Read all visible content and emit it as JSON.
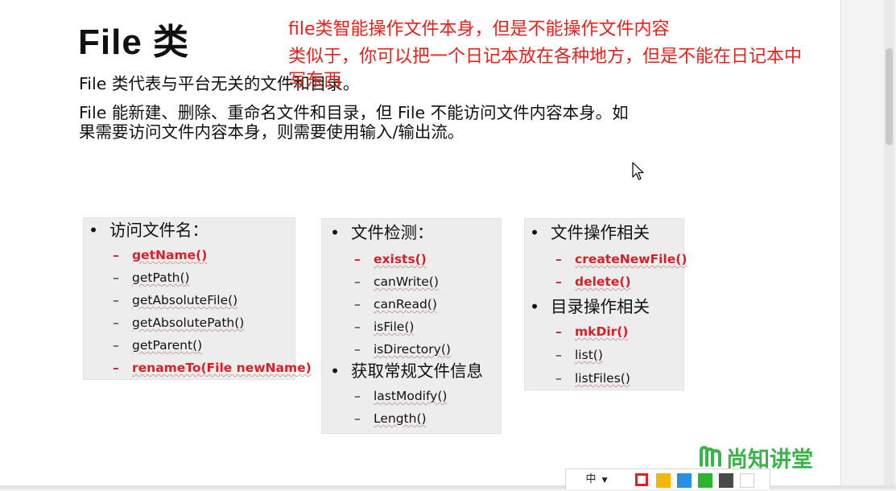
{
  "slide": {
    "title": "File 类",
    "paragraph1": "File 类代表与平台无关的文件和目录。",
    "paragraph2": "File  能新建、删除、重命名文件和目录，但 File 不能访问文件内容本身。如果需要访问文件内容本身，则需要使用输入/输出流。"
  },
  "annotation": {
    "line1": "file类智能操作文件本身，但是不能操作文件内容",
    "line2": "类似于，你可以把一个日记本放在各种地方，但是不能在日记本中",
    "line3": "写东西",
    "color": "#e8201a"
  },
  "box1": {
    "heading": "访问文件名：",
    "items": [
      {
        "text": "getName()",
        "highlight": true
      },
      {
        "text": "getPath()",
        "highlight": false
      },
      {
        "text": "getAbsoluteFile()",
        "highlight": false
      },
      {
        "text": "getAbsolutePath()",
        "highlight": false
      },
      {
        "text": "getParent()",
        "highlight": false
      },
      {
        "text": "renameTo(File newName)",
        "highlight": true
      }
    ]
  },
  "box2": {
    "heading": "文件检测：",
    "items": [
      {
        "text": "exists()",
        "highlight": true
      },
      {
        "text": "canWrite()",
        "highlight": false
      },
      {
        "text": "canRead()",
        "highlight": false
      },
      {
        "text": "isFile()",
        "highlight": false
      },
      {
        "text": "isDirectory()",
        "highlight": false
      }
    ],
    "heading2": "获取常规文件信息",
    "items2": [
      {
        "text": "lastModify()",
        "highlight": false
      },
      {
        "text": "Length()",
        "highlight": false
      }
    ]
  },
  "box3": {
    "heading": "文件操作相关",
    "items": [
      {
        "text": "createNewFile()",
        "highlight": true
      },
      {
        "text": "delete()",
        "highlight": true
      }
    ],
    "heading2": "目录操作相关",
    "items2": [
      {
        "text": "mkDir()",
        "highlight": true
      },
      {
        "text": "list()",
        "highlight": false
      },
      {
        "text": "listFiles()",
        "highlight": false
      }
    ]
  },
  "logo": {
    "text": "尚知讲堂",
    "icon": "logo-m-icon",
    "color": "#3ab449"
  },
  "toolbar": {
    "ime_label": "中",
    "ime_dropdown": "chevron-down-icon",
    "swatches": [
      {
        "name": "red",
        "color": "#e02020",
        "selected": true
      },
      {
        "name": "yellow",
        "color": "#f5b40a"
      },
      {
        "name": "blue",
        "color": "#2a8fe6"
      },
      {
        "name": "green",
        "color": "#2db32d"
      },
      {
        "name": "dark-gray",
        "color": "#4a4a4a"
      },
      {
        "name": "white",
        "color": "#ffffff"
      }
    ]
  },
  "colors": {
    "highlight_red": "#d91f26",
    "box_bg": "#ededed",
    "text": "#111111"
  }
}
